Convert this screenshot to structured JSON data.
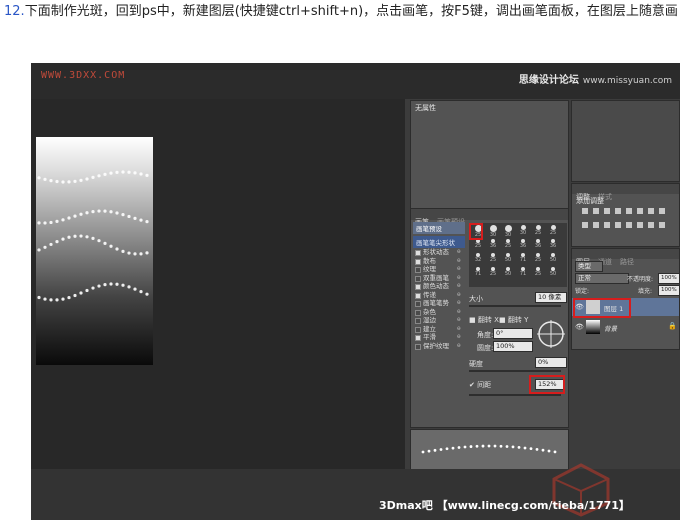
{
  "caption": {
    "number": "12.",
    "text": "下面制作光斑，回到ps中，新建图层(快捷键ctrl+shift+n)，点击画笔，按F5键，调出画笔面板，在图层上随意画"
  },
  "watermarks": {
    "top_left": "WWW.3DXX.COM",
    "top_right_brand": "思缘设计论坛",
    "top_right_url": "www.missyuan.com",
    "bottom": "3Dmax吧 【www.linecg.com/tieba/1771】"
  },
  "no_attribute_panel": {
    "title": "无属性"
  },
  "brush_panel": {
    "tabs": [
      "画笔",
      "画笔预设"
    ],
    "preset_button": "画笔预设",
    "selected_item": "画笔笔尖形状",
    "items": [
      {
        "label": "形状动态",
        "checked": true
      },
      {
        "label": "散布",
        "checked": true
      },
      {
        "label": "纹理",
        "checked": false
      },
      {
        "label": "双重画笔",
        "checked": false
      },
      {
        "label": "颜色动态",
        "checked": true
      },
      {
        "label": "传递",
        "checked": true
      },
      {
        "label": "画笔笔势",
        "checked": false
      },
      {
        "label": "杂色",
        "checked": false
      },
      {
        "label": "湿边",
        "checked": false
      },
      {
        "label": "建立",
        "checked": false
      },
      {
        "label": "平滑",
        "checked": true
      },
      {
        "label": "保护纹理",
        "checked": false
      }
    ],
    "brush_sizes": [
      "30",
      "30",
      "30",
      "25",
      "25",
      "25",
      "36",
      "25",
      "36",
      "36",
      "36",
      "32",
      "25",
      "50",
      "71",
      "25",
      "50",
      "71",
      "25",
      "50",
      "71",
      "25",
      "50",
      "71"
    ],
    "first_size": "25",
    "size_label": "大小",
    "size_value": "10 像素",
    "flip_x": "翻转 X",
    "flip_y": "翻转 Y",
    "angle_label": "角度:",
    "angle_value": "0°",
    "roundness_label": "圆度:",
    "roundness_value": "100%",
    "hardness_label": "硬度",
    "hardness_value": "0%",
    "spacing_label": "间距",
    "spacing_value": "152%",
    "spacing_checked": true
  },
  "adjustments_panel": {
    "tabs": [
      "调整",
      "样式"
    ],
    "subtitle": "添加调整"
  },
  "layers_panel": {
    "tabs": [
      "图层",
      "通道",
      "路径"
    ],
    "filter_label": "类型",
    "blend_mode": "正常",
    "opacity_label": "不透明度:",
    "opacity_value": "100%",
    "lock_label": "锁定:",
    "fill_label": "填充:",
    "fill_value": "100%",
    "layers": [
      {
        "name": "图层 1",
        "visible": true,
        "selected": true
      },
      {
        "name": "背景",
        "visible": true,
        "selected": false
      }
    ]
  },
  "colors": {
    "highlight_red": "#d61d1d",
    "selection_blue": "#3e5a8e",
    "panel_bg": "#535353"
  }
}
